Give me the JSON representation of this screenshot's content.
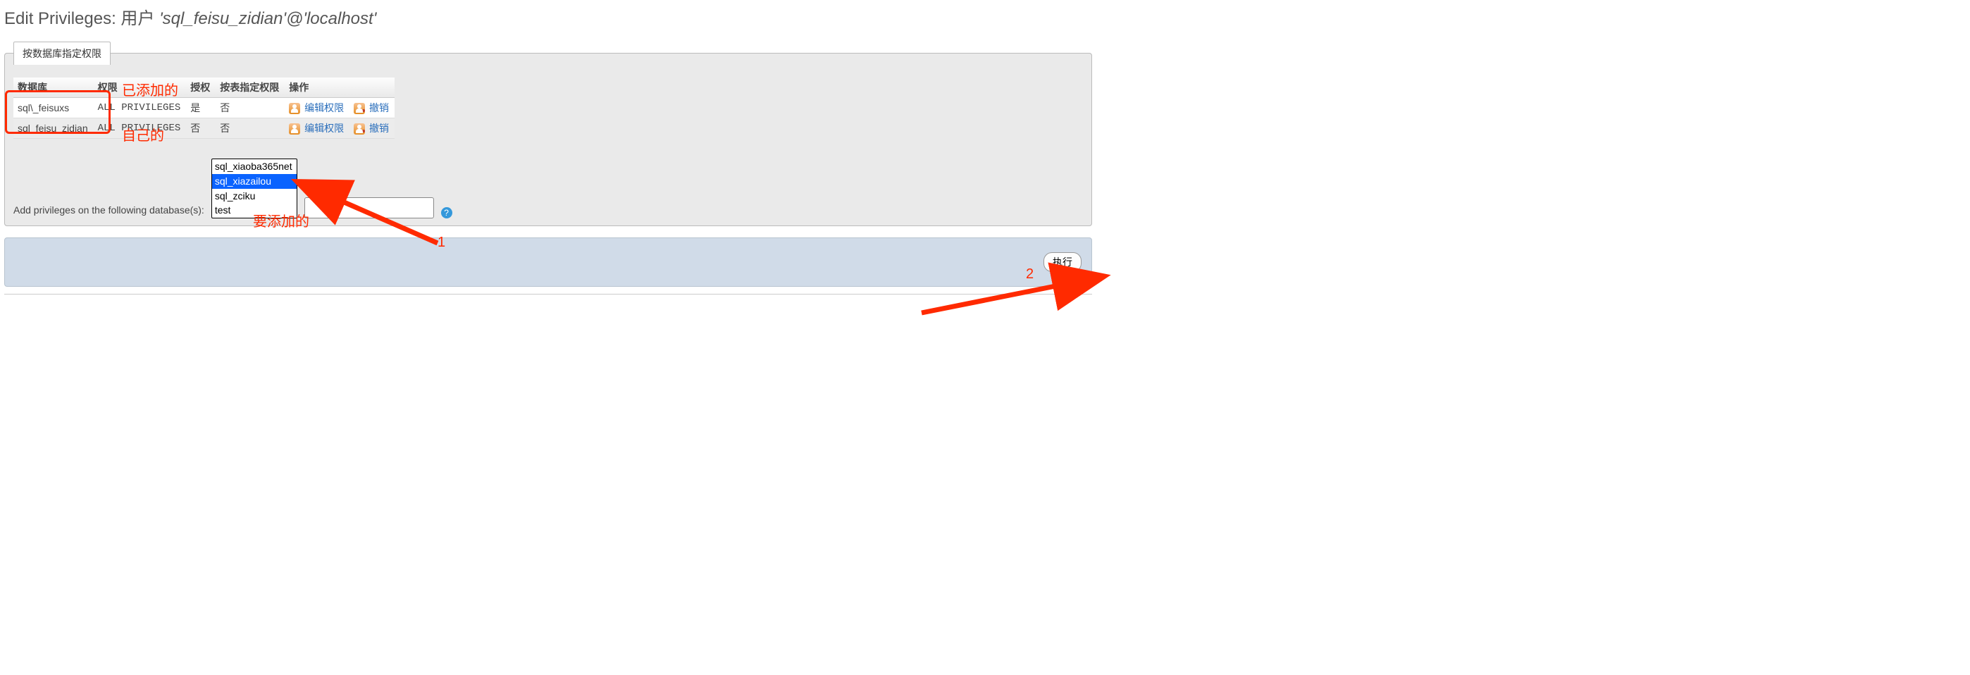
{
  "title_prefix": "Edit Privileges: 用户 ",
  "title_user": "'sql_feisu_zidian'@'localhost'",
  "panel_legend": "按数据库指定权限",
  "columns": {
    "db": "数据库",
    "priv": "权限",
    "grant": "授权",
    "tablespec": "按表指定权限",
    "action": "操作"
  },
  "rows": [
    {
      "db": "sql\\_feisuxs",
      "priv": "ALL PRIVILEGES",
      "grant": "是",
      "tablespec": "否"
    },
    {
      "db": "sql_feisu_zidian",
      "priv": "ALL PRIVILEGES",
      "grant": "否",
      "tablespec": "否"
    }
  ],
  "action_labels": {
    "edit": "编辑权限",
    "revoke": "撤销"
  },
  "add_label": "Add privileges on the following database(s):",
  "db_options": [
    {
      "value": "sql_xiaoba365net",
      "selected": false
    },
    {
      "value": "sql_xiazailou",
      "selected": true
    },
    {
      "value": "sql_zciku",
      "selected": false
    },
    {
      "value": "test",
      "selected": false
    }
  ],
  "pattern_value": "",
  "go_label": "执行",
  "annotations": {
    "added": "已添加的",
    "own": "自己的",
    "toadd": "要添加的",
    "one": "1",
    "two": "2"
  }
}
